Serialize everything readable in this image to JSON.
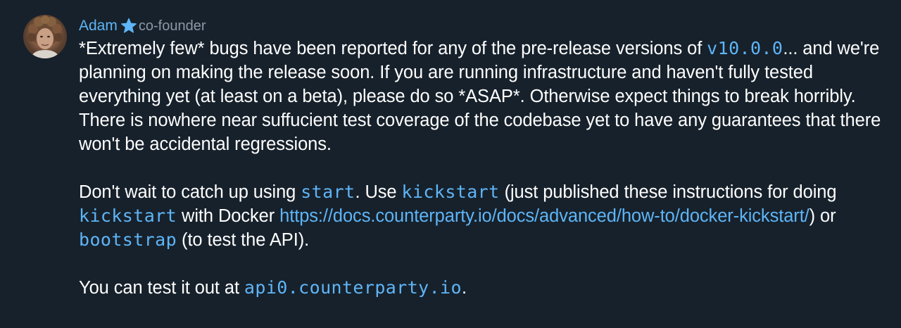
{
  "message": {
    "sender_name": "Adam",
    "sender_role": "co-founder",
    "badge_icon": "star-icon",
    "accent_color": "#5eb5f7",
    "background_color": "#17212b",
    "paragraph1": {
      "t1": "*Extremely few* bugs have been reported for any of the pre-release versions of ",
      "code_version": "v10.0.0",
      "t2": "... and we're planning on making the release soon. If you are running infrastructure and haven't fully tested everything yet (at least on a beta), please do so *ASAP*. Otherwise expect things to break horribly. There is nowhere near suffucient test coverage of the codebase yet to have any guarantees that there won't be accidental regressions."
    },
    "paragraph2": {
      "t1": "Don't wait to catch up using ",
      "code_start": "start",
      "t2": ". Use ",
      "code_kickstart": "kickstart",
      "t3": " (just published these instructions for doing ",
      "code_kickstart2": "kickstart",
      "t4": " with Docker ",
      "link_docs": "https://docs.counterparty.io/docs/advanced/how-to/docker-kickstart/",
      "t5": ") or ",
      "code_bootstrap": "bootstrap",
      "t6": " (to test the API)."
    },
    "paragraph3": {
      "t1": "You can test it out at ",
      "code_api": "api0.counterparty.io",
      "t2": "."
    }
  }
}
